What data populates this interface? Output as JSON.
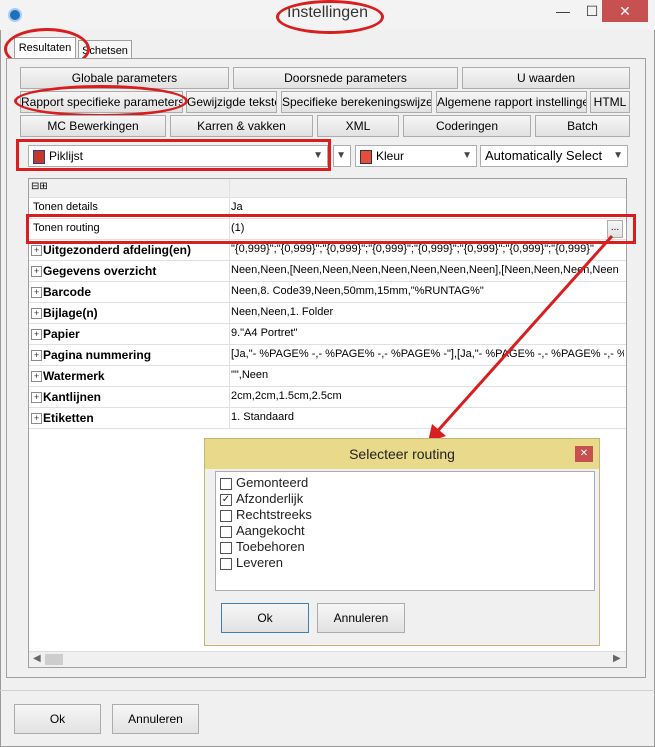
{
  "window": {
    "title": "Instellingen",
    "minimize": "—",
    "maximize": "☐",
    "close": "✕"
  },
  "tabs": [
    {
      "label": "Resultaten"
    },
    {
      "label": "Schetsen"
    }
  ],
  "buttons_row1": [
    "Globale parameters",
    "Doorsnede parameters",
    "U waarden"
  ],
  "buttons_row2": [
    "Rapport specifieke parameters",
    "Gewijzigde teksten",
    "Specifieke berekeningswijzen",
    "Algemene rapport instellingen",
    "HTML"
  ],
  "buttons_row3": [
    "MC Bewerkingen",
    "Karren & vakken",
    "XML",
    "Coderingen",
    "Batch"
  ],
  "combos": {
    "report": "Piklijst",
    "color": "Kleur",
    "select": "Automatically Select"
  },
  "grid": {
    "header_toggle": "⊟⊞",
    "rows": [
      {
        "name": "Tonen details",
        "value": "Ja"
      },
      {
        "name": "Tonen routing",
        "value": "(1)",
        "ellipsis": "..."
      },
      {
        "name": "Uitgezonderd afdeling(en)",
        "value": "\"{0,999}\";\"{0,999}\";\"{0,999}\";\"{0,999}\";\"{0,999}\";\"{0,999}\";\"{0,999}\";\"{0,999}\""
      },
      {
        "name": "Gegevens overzicht",
        "value": "Neen,Neen,[Neen,Neen,Neen,Neen,Neen,Neen,Neen],[Neen,Neen,Neen,Neen"
      },
      {
        "name": "Barcode",
        "value": "Neen,8. Code39,Neen,50mm,15mm,\"%RUNTAG%\""
      },
      {
        "name": "Bijlage(n)",
        "value": "Neen,Neen,1. Folder"
      },
      {
        "name": "Papier",
        "value": "9.\"A4 Portret\""
      },
      {
        "name": "Pagina nummering",
        "value": "[Ja,\"- %PAGE% -,- %PAGE% -,- %PAGE% -\"],[Ja,\"- %PAGE% -,- %PAGE% -,- %PAGE"
      },
      {
        "name": "Watermerk",
        "value": "\"\",Neen"
      },
      {
        "name": "Kantlijnen",
        "value": "2cm,2cm,1.5cm,2.5cm"
      },
      {
        "name": "Etiketten",
        "value": "1. Standaard"
      }
    ]
  },
  "dialog": {
    "title": "Selecteer routing",
    "items": [
      {
        "label": "Gemonteerd",
        "checked": false
      },
      {
        "label": "Afzonderlijk",
        "checked": true
      },
      {
        "label": "Rechtstreeks",
        "checked": false
      },
      {
        "label": "Aangekocht",
        "checked": false
      },
      {
        "label": "Toebehoren",
        "checked": false
      },
      {
        "label": "Leveren",
        "checked": false
      }
    ],
    "ok": "Ok",
    "cancel": "Annuleren"
  },
  "footer": {
    "ok": "Ok",
    "cancel": "Annuleren"
  },
  "colors": {
    "highlight": "#d81e1e",
    "dialog_title": "#e9d98a"
  }
}
